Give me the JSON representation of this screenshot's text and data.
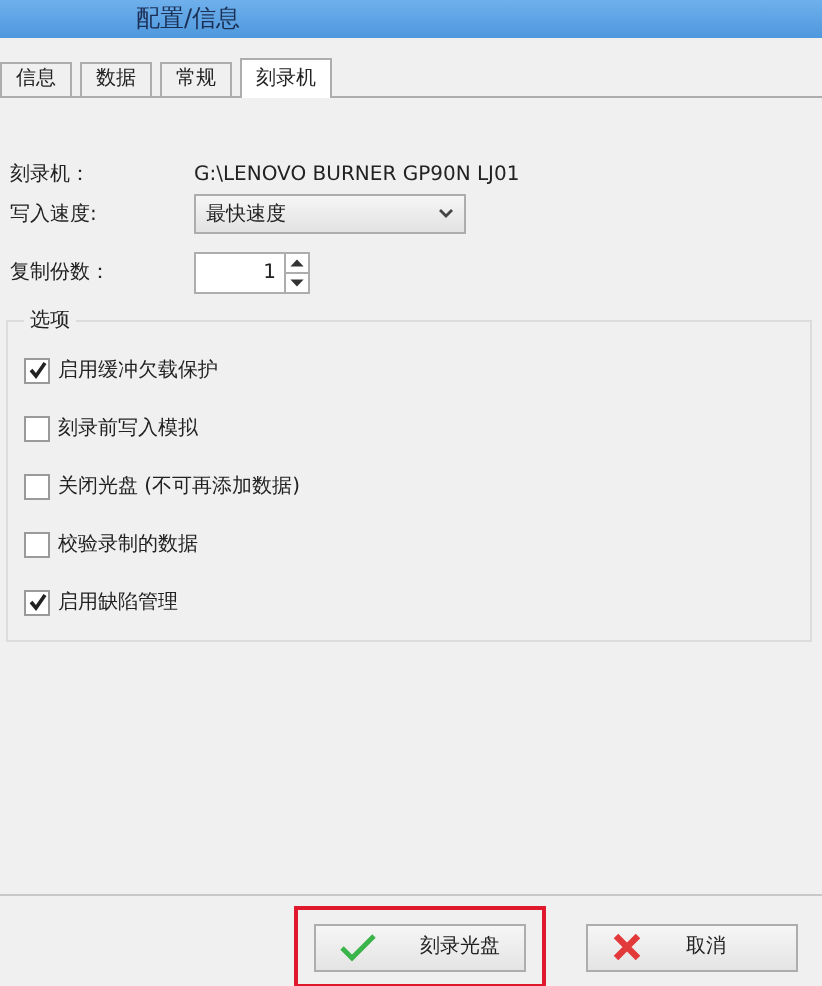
{
  "window": {
    "title": "配置/信息"
  },
  "tabs": [
    {
      "label": "信息",
      "selected": false
    },
    {
      "label": "数据",
      "selected": false
    },
    {
      "label": "常规",
      "selected": false
    },
    {
      "label": "刻录机",
      "selected": true
    }
  ],
  "recorder": {
    "label": "刻录机：",
    "value": "G:\\LENOVO BURNER GP90N LJ01"
  },
  "write_speed": {
    "label": "写入速度:",
    "value": "最快速度"
  },
  "copies": {
    "label": "复制份数：",
    "value": "1"
  },
  "options": {
    "title": "选项",
    "items": [
      {
        "label": "启用缓冲欠载保护",
        "checked": true
      },
      {
        "label": "刻录前写入模拟",
        "checked": false
      },
      {
        "label": "关闭光盘 (不可再添加数据)",
        "checked": false
      },
      {
        "label": "校验录制的数据",
        "checked": false
      },
      {
        "label": "启用缺陷管理",
        "checked": true
      }
    ]
  },
  "buttons": [
    {
      "label": "刻录光盘",
      "kind": "ok",
      "highlighted": true
    },
    {
      "label": "取消",
      "kind": "cancel",
      "highlighted": false
    }
  ]
}
